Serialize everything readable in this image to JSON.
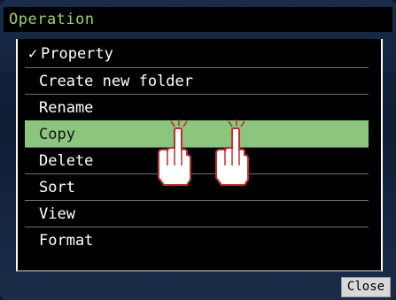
{
  "window": {
    "title": "Operation"
  },
  "menu": {
    "check_mark": "✓",
    "items": [
      {
        "label": "Property"
      },
      {
        "label": "Create new folder"
      },
      {
        "label": "Rename"
      },
      {
        "label": "Copy"
      },
      {
        "label": "Delete"
      },
      {
        "label": "Sort"
      },
      {
        "label": "View"
      },
      {
        "label": "Format"
      }
    ],
    "selected_item": "Copy",
    "checked_item": "Property"
  },
  "close_button": {
    "label": "Close"
  },
  "colors": {
    "title_text": "#9bd36f",
    "selected_row": "#8cc57e",
    "background": "#0b1830",
    "hand_outline": "#c42d2d"
  },
  "annotations": {
    "touch_hint": "hand-pointer-icon (double tap)"
  }
}
